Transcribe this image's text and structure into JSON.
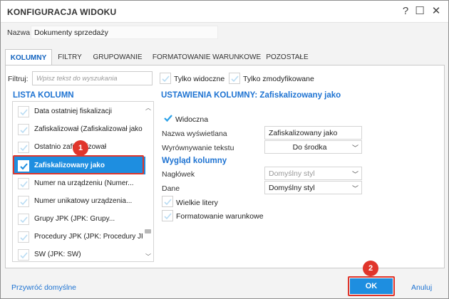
{
  "window": {
    "title": "KONFIGURACJA WIDOKU",
    "help": "?",
    "maximize": "☐",
    "close": "✕"
  },
  "name_row": {
    "label": "Nazwa:",
    "value": "Dokumenty sprzedaży"
  },
  "tabs": [
    {
      "label": "KOLUMNY",
      "active": true
    },
    {
      "label": "FILTRY",
      "active": false
    },
    {
      "label": "GRUPOWANIE",
      "active": false
    },
    {
      "label": "FORMATOWANIE WARUNKOWE",
      "active": false
    },
    {
      "label": "POZOSTAŁE",
      "active": false
    }
  ],
  "filter": {
    "label": "Filtruj:",
    "placeholder": "Wpisz tekst do wyszukania",
    "only_visible": "Tylko widoczne",
    "only_modified": "Tylko zmodyfikowane"
  },
  "columns_list": {
    "title": "LISTA KOLUMN",
    "items": [
      {
        "label": "Data ostatniej fiskalizacji",
        "checked": false,
        "selected": false
      },
      {
        "label": "Zafiskalizował (Zafiskalizował jako...",
        "checked": false,
        "selected": false
      },
      {
        "label": "Ostatnio zafiskalizował",
        "checked": false,
        "selected": false
      },
      {
        "label": "Zafiskalizowany jako",
        "checked": true,
        "selected": true
      },
      {
        "label": "Numer na urządzeniu (Numer...",
        "checked": false,
        "selected": false
      },
      {
        "label": "Numer unikatowy urządzenia...",
        "checked": false,
        "selected": false
      },
      {
        "label": "Grupy JPK (JPK: Grupy...",
        "checked": false,
        "selected": false
      },
      {
        "label": "Procedury JPK (JPK: Procedury JPK)",
        "checked": false,
        "selected": false
      },
      {
        "label": "SW (JPK: SW)",
        "checked": false,
        "selected": false
      }
    ]
  },
  "column_settings": {
    "title": "USTAWIENIA KOLUMNY: Zafiskalizowany jako",
    "visible_label": "Widoczna",
    "display_name_label": "Nazwa wyświetlana",
    "display_name_value": "Zafiskalizowany jako",
    "align_label": "Wyrównywanie tekstu",
    "align_value": "Do środka",
    "appearance_title": "Wygląd kolumny",
    "header_label": "Nagłówek",
    "header_value": "Domyślny styl",
    "data_label": "Dane",
    "data_value": "Domyślny styl",
    "uppercase_label": "Wielkie litery",
    "conditional_label": "Formatowanie warunkowe"
  },
  "markers": {
    "one": "1",
    "two": "2"
  },
  "footer": {
    "restore_defaults": "Przywróć domyślne",
    "ok": "OK",
    "cancel": "Anuluj"
  },
  "colors": {
    "accent": "#1e73d2",
    "selection": "#1e8ee0",
    "highlight": "#e0352b",
    "check": "#29a0e8"
  }
}
